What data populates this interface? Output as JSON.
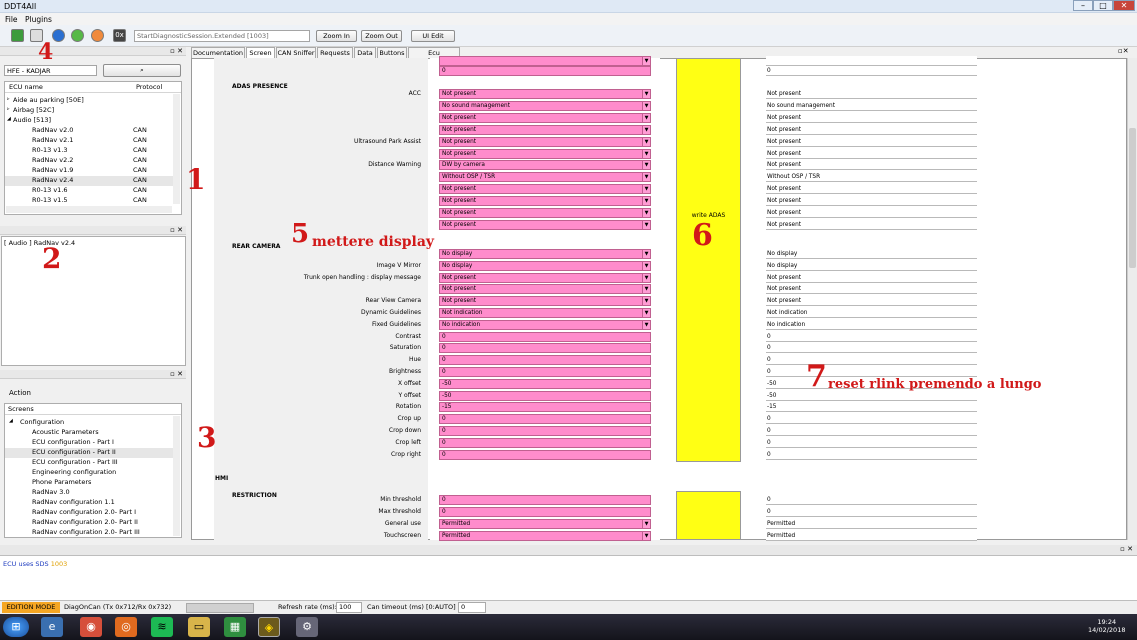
{
  "window": {
    "title": "DDT4All",
    "controls": [
      "–",
      "□",
      "✕"
    ]
  },
  "menu": {
    "file": "File",
    "plugins": "Plugins"
  },
  "toolbar": {
    "session": "StartDiagnosticSession.Extended [1003]",
    "zoom_in": "Zoom In",
    "zoom_out": "Zoom Out",
    "ui_edit": "UI Edit",
    "hex_icon": "0x"
  },
  "left": {
    "vehicle": "HFE - KADJAR",
    "col_name": "ECU name",
    "col_protocol": "Protocol",
    "tree": [
      {
        "name": "Aide au parking [50E]",
        "protocol": "",
        "level": 0,
        "exp": "▹"
      },
      {
        "name": "Airbag [52C]",
        "protocol": "",
        "level": 0,
        "exp": "▹"
      },
      {
        "name": "Audio [513]",
        "protocol": "",
        "level": 0,
        "exp": "◢"
      },
      {
        "name": "RadNav v2.0",
        "protocol": "CAN",
        "level": 1,
        "exp": ""
      },
      {
        "name": "RadNav v2.1",
        "protocol": "CAN",
        "level": 1,
        "exp": ""
      },
      {
        "name": "R0-13 v1.3",
        "protocol": "CAN",
        "level": 1,
        "exp": ""
      },
      {
        "name": "RadNav v2.2",
        "protocol": "CAN",
        "level": 1,
        "exp": ""
      },
      {
        "name": "RadNav v1.9",
        "protocol": "CAN",
        "level": 1,
        "exp": ""
      },
      {
        "name": "RadNav v2.4",
        "protocol": "CAN",
        "level": 1,
        "exp": ""
      },
      {
        "name": "R0-13 v1.6",
        "protocol": "CAN",
        "level": 1,
        "exp": ""
      },
      {
        "name": "R0-13 v1.5",
        "protocol": "CAN",
        "level": 1,
        "exp": ""
      }
    ],
    "selected": "[ Audio ] RadNav v2.4",
    "action_label": "Action",
    "screens_label": "Screens",
    "screens": [
      {
        "name": "Configuration",
        "level": 0,
        "exp": "◢"
      },
      {
        "name": "Acoustic Parameters",
        "level": 1,
        "exp": ""
      },
      {
        "name": "ECU configuration - Part I",
        "level": 1,
        "exp": ""
      },
      {
        "name": "ECU configuration - Part II",
        "level": 1,
        "exp": ""
      },
      {
        "name": "ECU configuration - Part III",
        "level": 1,
        "exp": ""
      },
      {
        "name": "Engineering configuration",
        "level": 1,
        "exp": ""
      },
      {
        "name": "Phone Parameters",
        "level": 1,
        "exp": ""
      },
      {
        "name": "RadNav 3.0",
        "level": 1,
        "exp": ""
      },
      {
        "name": "RadNav configuration 1.1",
        "level": 1,
        "exp": ""
      },
      {
        "name": "RadNav configuration 2.0- Part I",
        "level": 1,
        "exp": ""
      },
      {
        "name": "RadNav configuration 2.0- Part II",
        "level": 1,
        "exp": ""
      },
      {
        "name": "RadNav configuration 2.0- Part III",
        "level": 1,
        "exp": ""
      }
    ]
  },
  "annotations": {
    "a1": "1",
    "a2": "2",
    "a3": "3",
    "a4": "4",
    "a5_num": "5",
    "a5_text": "mettere display",
    "a6": "6",
    "a7_num": "7",
    "a7_text": "reset rlink premendo a lungo"
  },
  "tabs": [
    "Documentation",
    "Screen",
    "CAN Sniffer",
    "Requests",
    "Data",
    "Buttons",
    "Ecu parameters"
  ],
  "screen": {
    "sections": {
      "adas": "ADAS PRESENCE",
      "rear": "REAR CAMERA",
      "hmi": "HMI",
      "restriction": "RESTRICTION"
    },
    "write_adas": "write ADAS",
    "top_row": {
      "value": "0",
      "result": "0"
    },
    "adas_rows": [
      {
        "label": "ACC",
        "value": "Not present",
        "result": "Not present"
      },
      {
        "label": "",
        "value": "No sound management",
        "result": "No sound management"
      },
      {
        "label": "",
        "value": "Not present",
        "result": "Not present"
      },
      {
        "label": "",
        "value": "Not present",
        "result": "Not present"
      },
      {
        "label": "Ultrasound Park Assist",
        "value": "Not present",
        "result": "Not present"
      },
      {
        "label": "",
        "value": "Not present",
        "result": "Not present"
      },
      {
        "label": "Distance Warning",
        "value": "DW by camera",
        "result": "Not present"
      },
      {
        "label": "",
        "value": "Without OSP / TSR",
        "result": "Without OSP / TSR"
      },
      {
        "label": "",
        "value": "Not present",
        "result": "Not present"
      },
      {
        "label": "",
        "value": "Not present",
        "result": "Not present"
      },
      {
        "label": "",
        "value": "Not present",
        "result": "Not present"
      },
      {
        "label": "",
        "value": "Not present",
        "result": "Not present"
      }
    ],
    "rear_rows": [
      {
        "label": "",
        "value": "No display",
        "result": "No display",
        "dd": true
      },
      {
        "label": "Image V Mirror",
        "value": "No display",
        "result": "No display",
        "dd": true
      },
      {
        "label": "Trunk open handling : display message",
        "value": "Not present",
        "result": "Not present",
        "dd": true
      },
      {
        "label": "",
        "value": "Not present",
        "result": "Not present",
        "dd": true
      },
      {
        "label": "Rear View Camera",
        "value": "Not present",
        "result": "Not present",
        "dd": true
      },
      {
        "label": "Dynamic Guidelines",
        "value": "Not indication",
        "result": "Not indication",
        "dd": true
      },
      {
        "label": "Fixed Guidelines",
        "value": "No indication",
        "result": "No indication",
        "dd": true
      },
      {
        "label": "Contrast",
        "value": "0",
        "result": "0",
        "dd": false
      },
      {
        "label": "Saturation",
        "value": "0",
        "result": "0",
        "dd": false
      },
      {
        "label": "Hue",
        "value": "0",
        "result": "0",
        "dd": false
      },
      {
        "label": "Brightness",
        "value": "0",
        "result": "0",
        "dd": false
      },
      {
        "label": "X offset",
        "value": "-50",
        "result": "-50",
        "dd": false
      },
      {
        "label": "Y offset",
        "value": "-50",
        "result": "-50",
        "dd": false
      },
      {
        "label": "Rotation",
        "value": "-15",
        "result": "-15",
        "dd": false
      },
      {
        "label": "Crop up",
        "value": "0",
        "result": "0",
        "dd": false
      },
      {
        "label": "Crop down",
        "value": "0",
        "result": "0",
        "dd": false
      },
      {
        "label": "Crop left",
        "value": "0",
        "result": "0",
        "dd": false
      },
      {
        "label": "Crop right",
        "value": "0",
        "result": "0",
        "dd": false
      }
    ],
    "restriction_rows": [
      {
        "label": "Min threshold",
        "value": "0",
        "result": "0",
        "dd": false
      },
      {
        "label": "Max threshold",
        "value": "0",
        "result": "0",
        "dd": false
      },
      {
        "label": "General use",
        "value": "Permitted",
        "result": "Permitted",
        "dd": true
      },
      {
        "label": "Touchscreen",
        "value": "Permitted",
        "result": "Permitted",
        "dd": true
      }
    ]
  },
  "log": {
    "line_prefix": "ECU uses SDS",
    "line_code": "1003"
  },
  "status": {
    "mode": "EDITION MODE",
    "conn": "DiagOnCan (Tx 0x712/Rx 0x732)",
    "refresh_label": "Refresh rate (ms):",
    "refresh_value": "100",
    "timeout_label": "Can timeout (ms) [0:AUTO] :",
    "timeout_value": "0"
  },
  "taskbar": {
    "time": "19:24",
    "date": "14/02/2018"
  },
  "colors": {
    "pink": "#ff8ccc",
    "yellow": "#ffff14",
    "annotation_red": "#d11919",
    "edition_mode": "#f5a623"
  }
}
